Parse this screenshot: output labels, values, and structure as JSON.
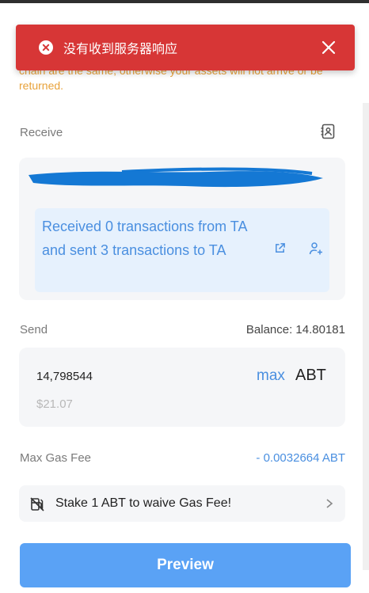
{
  "toast": {
    "message": "没有收到服务器响应",
    "icon": "error-circle-icon",
    "close_icon": "close-icon",
    "color": "#d73636"
  },
  "warning": {
    "text": "chain are the same, otherwise your assets will not arrive or be returned."
  },
  "receive": {
    "label": "Receive",
    "address_book_icon": "address-book-icon",
    "info_text": "Received 0 transactions from TA and sent 3 transactions to TA",
    "external_link_icon": "external-link-icon",
    "add_contact_icon": "add-contact-icon"
  },
  "send": {
    "label": "Send",
    "balance": "Balance: 14.80181",
    "amount_value": "14,798544",
    "usd_value": "$21.07",
    "max_label": "max",
    "token": "ABT"
  },
  "gas": {
    "label": "Max Gas Fee",
    "value": "- 0.0032664 ABT"
  },
  "stake": {
    "text": "Stake 1 ABT to waive Gas Fee!",
    "icon": "no-gas-icon",
    "chevron_icon": "chevron-right-icon"
  },
  "preview_button": {
    "label": "Preview"
  },
  "colors": {
    "accent": "#4a8fe0",
    "button": "#5aa2f5",
    "warning": "#e8a23a",
    "error": "#d73636"
  }
}
